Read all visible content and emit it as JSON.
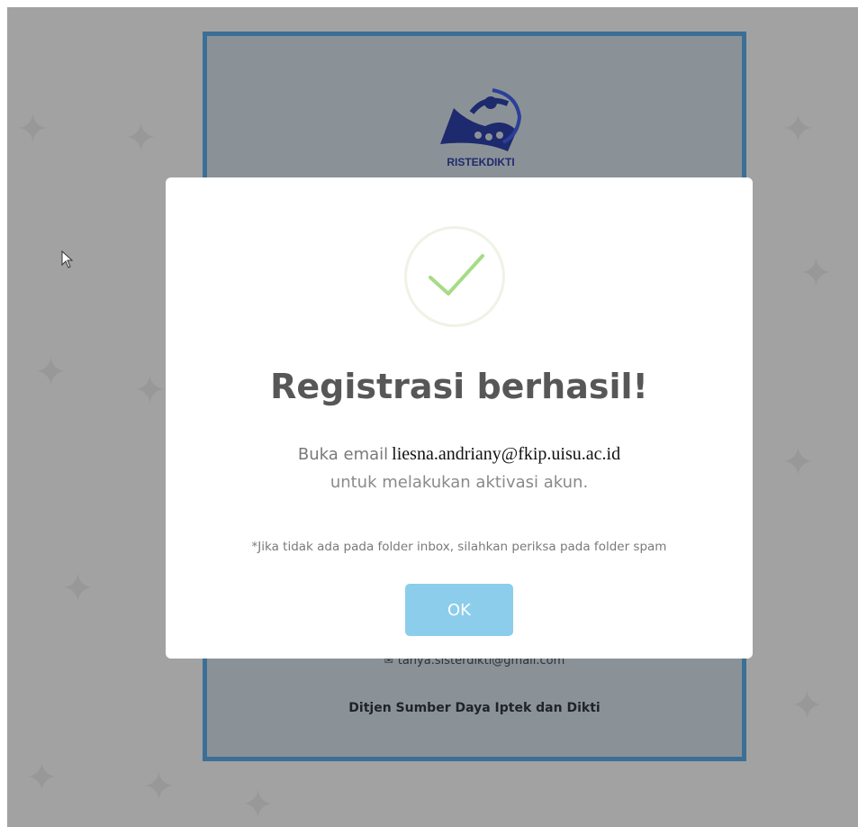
{
  "background": {
    "logo_text": "RISTEKDIKTI",
    "contact_email": "tanya.sisterdikti@gmail.com",
    "organization": "Ditjen Sumber Daya Iptek dan Dikti"
  },
  "dialog": {
    "icon": "success-check-icon",
    "title": "Registrasi berhasil!",
    "message_prefix": "Buka email",
    "email": "liesna.andriany@fkip.uisu.ac.id",
    "message_suffix": "untuk melakukan aktivasi akun.",
    "note": "*Jika tidak ada pada folder inbox, silahkan periksa pada folder spam",
    "ok_label": "OK"
  },
  "colors": {
    "overlay": "#a2a2a2",
    "panel_border": "#3c6f95",
    "check": "#a5dc86",
    "ok_button": "#8ccdeb"
  }
}
